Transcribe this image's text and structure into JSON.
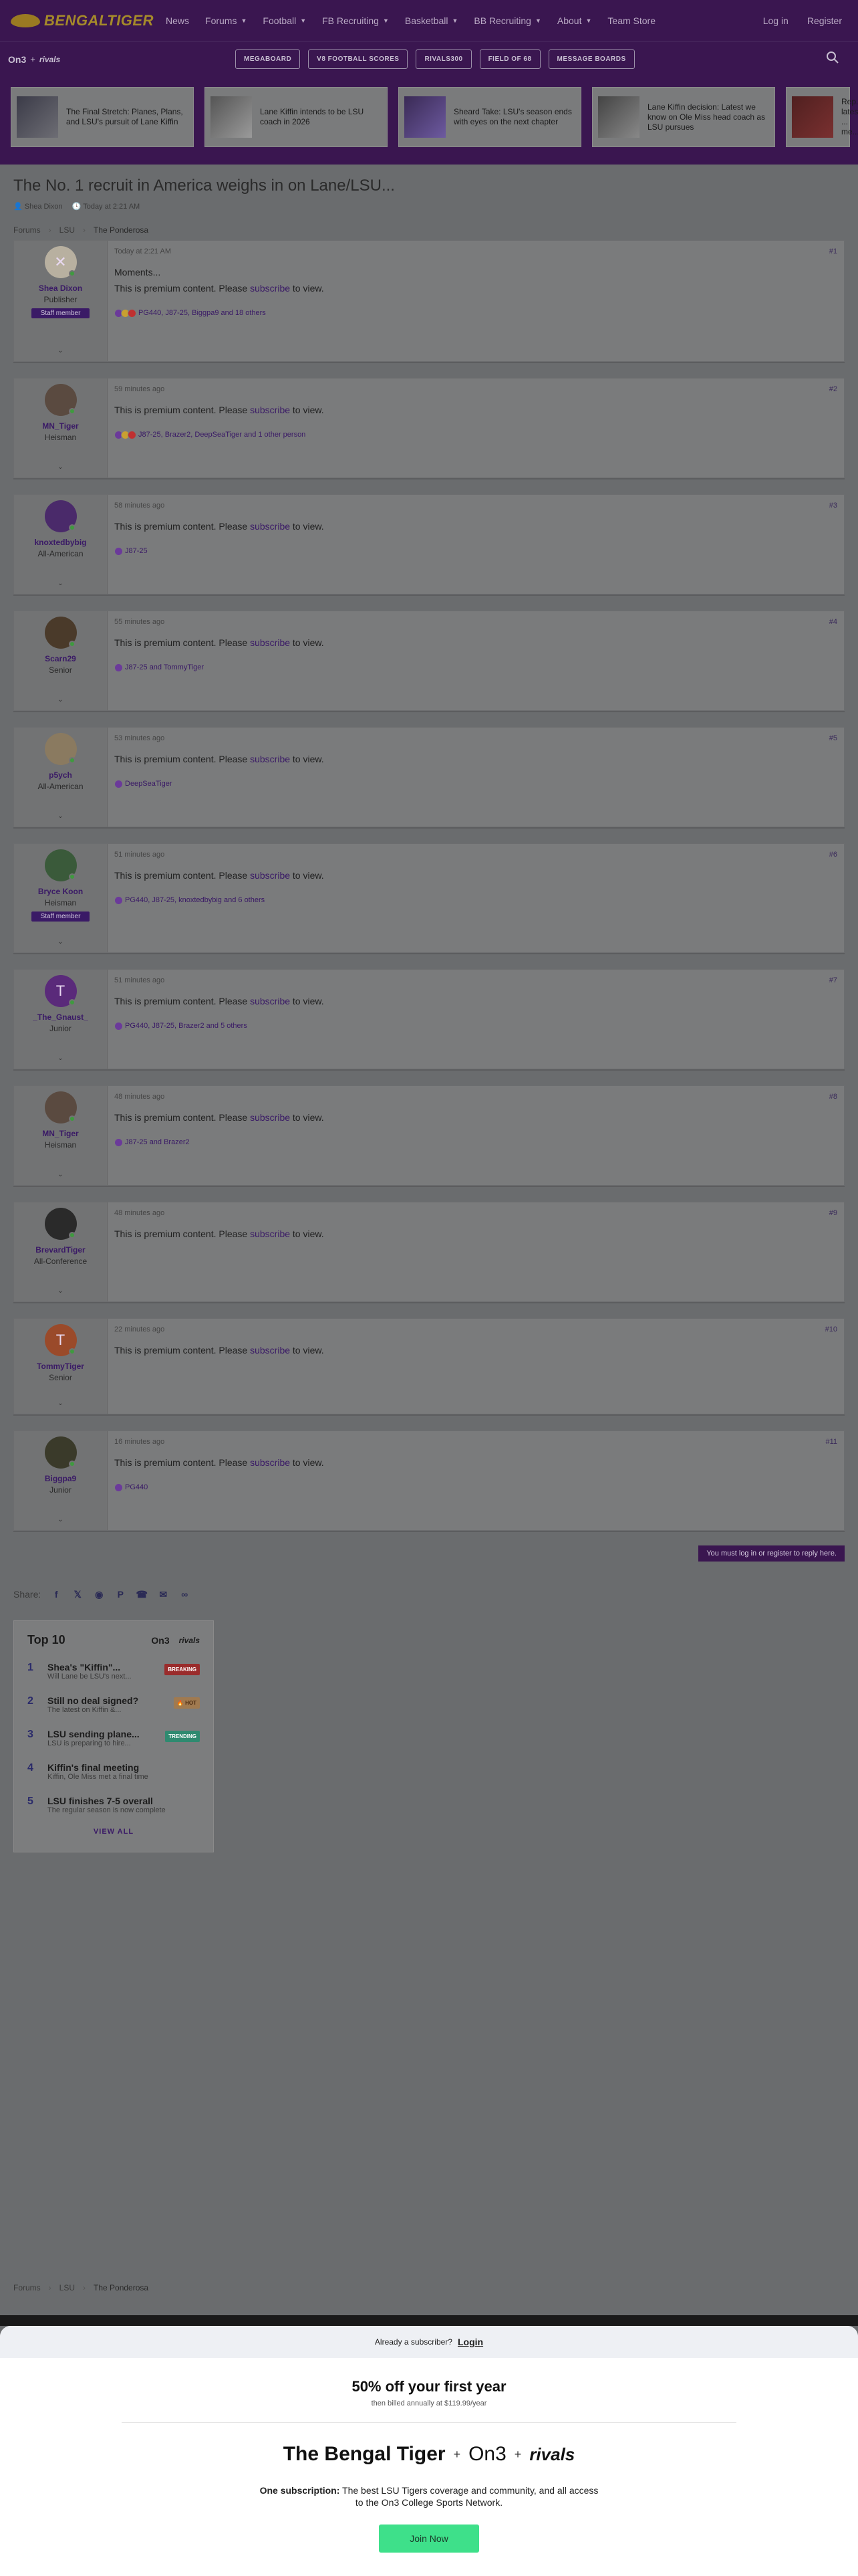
{
  "nav": {
    "logo_text": "BENGALTIGER",
    "links": [
      {
        "label": "News",
        "caret": false
      },
      {
        "label": "Forums",
        "caret": true
      },
      {
        "label": "Football",
        "caret": true
      },
      {
        "label": "FB Recruiting",
        "caret": true
      },
      {
        "label": "Basketball",
        "caret": true
      },
      {
        "label": "BB Recruiting",
        "caret": true
      },
      {
        "label": "About",
        "caret": true
      },
      {
        "label": "Team Store",
        "caret": false
      }
    ],
    "login": "Log in",
    "register": "Register"
  },
  "subbar": {
    "on3": "On3",
    "rivals": "rivals",
    "pills": [
      "MEGABOARD",
      "V8 FOOTBALL SCORES",
      "RIVALS300",
      "FIELD OF 68",
      "MESSAGE BOARDS"
    ]
  },
  "stories": [
    {
      "title": "The Final Stretch: Planes, Plans, and LSU's pursuit of Lane Kiffin"
    },
    {
      "title": "Lane Kiffin intends to be LSU coach in 2026"
    },
    {
      "title": "Sheard Take: LSU's season ends with eyes on the next chapter"
    },
    {
      "title": "Lane Kiffin decision: Latest we know on Ole Miss head coach as LSU pursues"
    },
    {
      "title": "Rep... latest ... me..."
    }
  ],
  "thread": {
    "title": "The No. 1 recruit in America weighs in on Lane/LSU...",
    "author": "Shea Dixon",
    "date": "Today at 2:21 AM"
  },
  "breadcrumb": [
    "Forums",
    "LSU",
    "The Ponderosa"
  ],
  "posts": [
    {
      "user": "Shea Dixon",
      "title": "Publisher",
      "staff": "Staff member",
      "time": "Today at 2:21 AM",
      "num": "#1",
      "lead": "Moments...",
      "text_before": "This is premium content. Please ",
      "link": "subscribe",
      "text_after": " to view.",
      "reactions": "PG440, J87-25, Biggpa9 and 18 others",
      "avatar_color": "#b8b0a0",
      "icon_text": "✕"
    },
    {
      "user": "MN_Tiger",
      "title": "Heisman",
      "staff": "",
      "time": "59 minutes ago",
      "num": "#2",
      "lead": "",
      "text_before": "This is premium content. Please ",
      "link": "subscribe",
      "text_after": " to view.",
      "reactions": "J87-25, Brazer2, DeepSeaTiger and 1 other person",
      "avatar_color": "#5a4a40",
      "icon_text": ""
    },
    {
      "user": "knoxtedbybig",
      "title": "All-American",
      "staff": "",
      "time": "58 minutes ago",
      "num": "#3",
      "lead": "",
      "text_before": "This is premium content. Please ",
      "link": "subscribe",
      "text_after": " to view.",
      "reactions": "J87-25",
      "avatar_color": "#4a2a6a",
      "icon_text": ""
    },
    {
      "user": "Scarn29",
      "title": "Senior",
      "staff": "",
      "time": "55 minutes ago",
      "num": "#4",
      "lead": "",
      "text_before": "This is premium content. Please ",
      "link": "subscribe",
      "text_after": " to view.",
      "reactions": "J87-25 and TommyTiger",
      "avatar_color": "#4a3a2a",
      "icon_text": ""
    },
    {
      "user": "p5ych",
      "title": "All-American",
      "staff": "",
      "time": "53 minutes ago",
      "num": "#5",
      "lead": "",
      "text_before": "This is premium content. Please ",
      "link": "subscribe",
      "text_after": " to view.",
      "reactions": "DeepSeaTiger",
      "avatar_color": "#8a7a60",
      "icon_text": ""
    },
    {
      "user": "Bryce Koon",
      "title": "Heisman",
      "staff": "Staff member",
      "time": "51 minutes ago",
      "num": "#6",
      "lead": "",
      "text_before": "This is premium content. Please ",
      "link": "subscribe",
      "text_after": " to view.",
      "reactions": "PG440, J87-25, knoxtedbybig and 6 others",
      "avatar_color": "#3a5a3a",
      "icon_text": ""
    },
    {
      "user": "_The_Gnaust_",
      "title": "Junior",
      "staff": "",
      "time": "51 minutes ago",
      "num": "#7",
      "lead": "",
      "text_before": "This is premium content. Please ",
      "link": "subscribe",
      "text_after": " to view.",
      "reactions": "PG440, J87-25, Brazer2 and 5 others",
      "avatar_color": "#5a2a7a",
      "icon_text": "T"
    },
    {
      "user": "MN_Tiger",
      "title": "Heisman",
      "staff": "",
      "time": "48 minutes ago",
      "num": "#8",
      "lead": "",
      "text_before": "This is premium content. Please ",
      "link": "subscribe",
      "text_after": " to view.",
      "reactions": "J87-25 and Brazer2",
      "avatar_color": "#5a4a40",
      "icon_text": ""
    },
    {
      "user": "BrevardTiger",
      "title": "All-Conference",
      "staff": "",
      "time": "48 minutes ago",
      "num": "#9",
      "lead": "",
      "text_before": "This is premium content. Please ",
      "link": "subscribe",
      "text_after": " to view.",
      "reactions": "",
      "avatar_color": "#2a2a2a",
      "icon_text": ""
    },
    {
      "user": "TommyTiger",
      "title": "Senior",
      "staff": "",
      "time": "22 minutes ago",
      "num": "#10",
      "lead": "",
      "text_before": "This is premium content. Please ",
      "link": "subscribe",
      "text_after": " to view.",
      "reactions": "",
      "avatar_color": "#9a4a2a",
      "icon_text": "T"
    },
    {
      "user": "Biggpa9",
      "title": "Junior",
      "staff": "",
      "time": "16 minutes ago",
      "num": "#11",
      "lead": "",
      "text_before": "This is premium content. Please ",
      "link": "subscribe",
      "text_after": " to view.",
      "reactions": "PG440",
      "avatar_color": "#3a3a2a",
      "icon_text": ""
    }
  ],
  "login_notice": "You must log in or register to reply here.",
  "share": {
    "label": "Share:",
    "icons": [
      "facebook-icon",
      "twitter-icon",
      "reddit-icon",
      "pinterest-icon",
      "whatsapp-icon",
      "email-icon",
      "link-icon"
    ]
  },
  "top10": {
    "title": "Top 10",
    "on3": "On3",
    "rivals": "rivals",
    "items": [
      {
        "rank": "1",
        "title": "Shea's \"Kiffin\"...",
        "sub": "Will Lane be LSU's next...",
        "badge": "BREAKING",
        "badge_class": "b-breaking"
      },
      {
        "rank": "2",
        "title": "Still no deal signed?",
        "sub": "The latest on Kiffin &...",
        "badge": "🔥 HOT",
        "badge_class": "b-hot"
      },
      {
        "rank": "3",
        "title": "LSU sending plane...",
        "sub": "LSU is preparing to hire...",
        "badge": "TRENDING",
        "badge_class": "b-trending"
      },
      {
        "rank": "4",
        "title": "Kiffin's final meeting",
        "sub": "Kiffin, Ole Miss met a final time",
        "badge": "",
        "badge_class": ""
      },
      {
        "rank": "5",
        "title": "LSU finishes 7-5 overall",
        "sub": "The regular season is now complete",
        "badge": "",
        "badge_class": ""
      }
    ],
    "view_all": "VIEW ALL"
  },
  "paywall": {
    "already": "Already a subscriber?",
    "login": "Login",
    "offer": "50% off your first year",
    "billed": "then billed annually at $119.99/year",
    "brand_bt": "The Bengal Tiger",
    "brand_on3": "On3",
    "brand_rivals": "rivals",
    "desc_bold": "One subscription:",
    "desc_line1": " The best LSU Tigers coverage and community, and all access",
    "desc_line2": "to the On3 College Sports Network.",
    "join": "Join Now"
  }
}
